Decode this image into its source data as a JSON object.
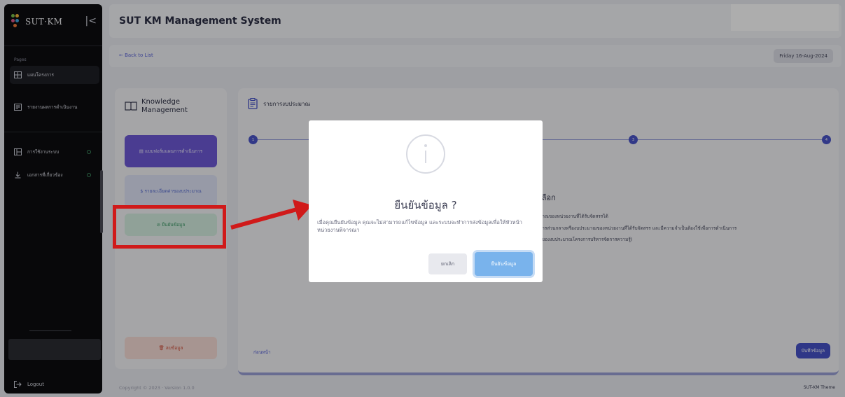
{
  "sidebar": {
    "logo_text": "SUT·KM",
    "collapse_icon": "collapse-left-icon",
    "section_title": "Pages",
    "items": [
      {
        "label": "แผนโครงการ",
        "icon": "grid-icon",
        "active": true
      },
      {
        "label": "รายงานผลการดำเนินงาน",
        "icon": "report-icon"
      },
      {
        "label": "การใช้งานระบบ",
        "icon": "layout-icon"
      },
      {
        "label": "เอกสารที่เกี่ยวข้อง",
        "icon": "download-icon"
      }
    ],
    "logout_label": "Logout"
  },
  "header": {
    "title": "SUT KM Management System",
    "back_label": "← Back to List",
    "date": "Friday 16-Aug-2024"
  },
  "left_panel": {
    "title_line1": "Knowledge",
    "title_line2": "Management",
    "steps": [
      "แบบฟอร์มแผนการดำเนินการ",
      "รายละเอียดค่าของบประมาณ",
      "ยืนยันข้อมูล"
    ],
    "delete_label": "ลบข้อมูล"
  },
  "main_panel": {
    "title": "รายการงบประมาณ",
    "steps": [
      "1",
      "3",
      "4"
    ],
    "heading_fragment": "เลือก",
    "text_lines": [
      "มาณของหน่วยงานที่ได้รับจัดสรรได้",
      "ทารส่วนกลางหรืองบประมาณของหน่วยงานที่ได้รับจัดสรร และมีความจำเป็นต้องใช้เพื่อการดำเนินการ",
      "จของงบประมาณโครงการบริหารจัดการความรู้)"
    ],
    "prev_label": "ก่อนหน้า",
    "save_label": "บันทึกข้อมูล"
  },
  "footer": {
    "copyright": "Copyright © 2023 · Version 1.0.0",
    "theme": "SUT-KM Theme"
  },
  "dialog": {
    "icon": "info-icon",
    "title": "ยืนยันข้อมูล ?",
    "message": "เมื่อคุณยืนยันข้อมูล คุณจะไม่สามารถแก้ไขข้อมูล และระบบจะทำการส่งข้อมูลเพื่อให้หัวหน้าหน่วยงานพิจารณา",
    "cancel_label": "ยกเลิก",
    "confirm_label": "ยืนยันข้อมูล"
  },
  "colors": {
    "primary": "#4652c8",
    "annotation_red": "#d01a1a",
    "confirm_button": "#79b3ec"
  }
}
